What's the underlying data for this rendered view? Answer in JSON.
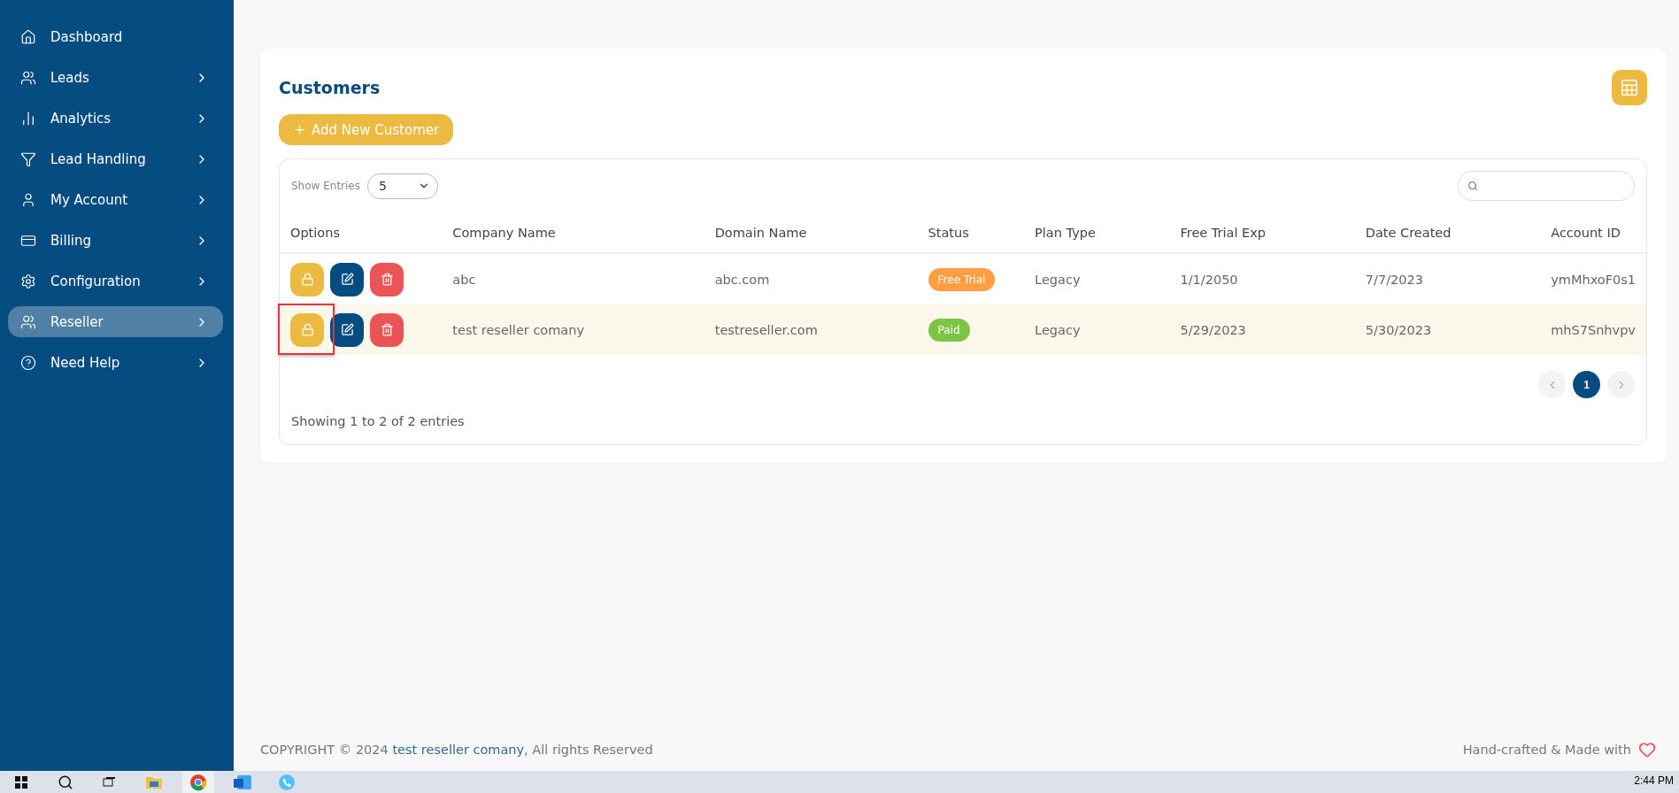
{
  "sidebar": {
    "items": [
      {
        "label": "Dashboard",
        "expandable": false,
        "selected": false
      },
      {
        "label": "Leads",
        "expandable": true,
        "selected": false
      },
      {
        "label": "Analytics",
        "expandable": true,
        "selected": false
      },
      {
        "label": "Lead Handling",
        "expandable": true,
        "selected": false
      },
      {
        "label": "My Account",
        "expandable": true,
        "selected": false
      },
      {
        "label": "Billing",
        "expandable": true,
        "selected": false
      },
      {
        "label": "Configuration",
        "expandable": true,
        "selected": false
      },
      {
        "label": "Reseller",
        "expandable": true,
        "selected": true
      },
      {
        "label": "Need Help",
        "expandable": true,
        "selected": false
      }
    ]
  },
  "customers": {
    "title": "Customers",
    "add_button": "Add New Customer",
    "show_entries_label": "Show Entries",
    "show_entries_value": "5",
    "table": {
      "columns": [
        "Options",
        "Company Name",
        "Domain Name",
        "Status",
        "Plan Type",
        "Free Trial Exp",
        "Date Created",
        "Account ID"
      ],
      "rows": [
        {
          "selected": false,
          "lock_highlighted": false,
          "company": "abc",
          "domain": "abc.com",
          "status": {
            "label": "Free Trial",
            "color": "#ff9f43"
          },
          "plan": "Legacy",
          "trial_exp": "1/1/2050",
          "created": "7/7/2023",
          "account_id": "ymMhxoF0s1"
        },
        {
          "selected": true,
          "lock_highlighted": true,
          "company": "test reseller comany",
          "domain": "testreseller.com",
          "status": {
            "label": "Paid",
            "color": "#7cc444"
          },
          "plan": "Legacy",
          "trial_exp": "5/29/2023",
          "created": "5/30/2023",
          "account_id": "mhS7Snhvpv"
        }
      ]
    },
    "pages": [
      {
        "label": "1",
        "selected": true
      }
    ],
    "summary": "Showing 1 to 2 of 2 entries"
  },
  "footer": {
    "copyright_prefix": "COPYRIGHT © 2024",
    "company_link": "test reseller comany",
    "copyright_suffix": ", All rights Reserved",
    "made_with": "Hand-crafted & Made with"
  },
  "taskbar": {
    "clock": "2:44 PM"
  }
}
